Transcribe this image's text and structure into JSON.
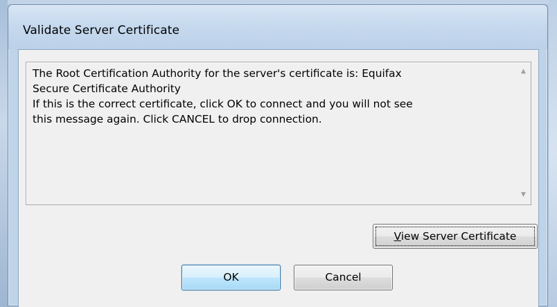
{
  "window": {
    "title": "Validate Server Certificate"
  },
  "message": {
    "lines": [
      "The Root Certification Authority for the server's certificate is: Equifax",
      "Secure Certificate Authority",
      "If this is the correct certificate, click OK to connect and you will not see",
      "this message again.  Click CANCEL to drop connection."
    ]
  },
  "scrollbar": {
    "up_icon": "scroll-up-arrow",
    "down_icon": "scroll-down-arrow"
  },
  "buttons": {
    "view_cert_accel": "V",
    "view_cert_rest": "iew Server Certificate",
    "ok": "OK",
    "cancel": "Cancel"
  },
  "colors": {
    "title_bar": "#c6d9ee",
    "client_bg": "#f0f0f0",
    "default_button": "#bee6fd"
  }
}
